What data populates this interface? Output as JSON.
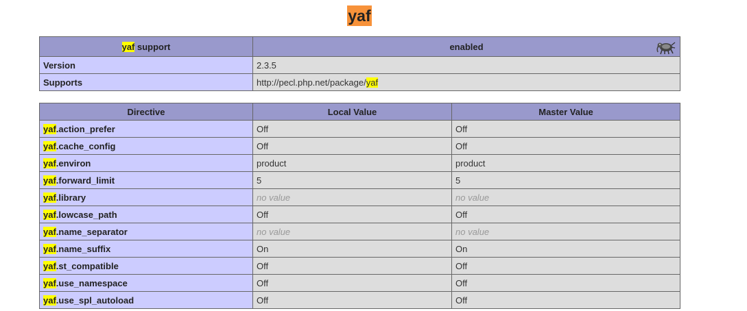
{
  "highlight_colors": {
    "search_hit": "#ffff00",
    "current_hit": "#f7923a"
  },
  "title": "yaf",
  "info_table": {
    "header": {
      "name_prefix": "yaf",
      "name_suffix": " support",
      "value": "enabled"
    },
    "logo_icon": "elephant-icon",
    "rows": [
      {
        "label": "Version",
        "value": "2.3.5"
      },
      {
        "label": "Supports",
        "value_prefix": "http://pecl.php.net/package/",
        "value_hit": "yaf"
      }
    ]
  },
  "directive_table": {
    "headers": [
      "Directive",
      "Local Value",
      "Master Value"
    ],
    "prefix": "yaf",
    "no_value": "no value",
    "rows": [
      {
        "name": ".action_prefer",
        "local": "Off",
        "master": "Off"
      },
      {
        "name": ".cache_config",
        "local": "Off",
        "master": "Off"
      },
      {
        "name": ".environ",
        "local": "product",
        "master": "product"
      },
      {
        "name": ".forward_limit",
        "local": "5",
        "master": "5"
      },
      {
        "name": ".library",
        "local": "no value",
        "master": "no value",
        "local_nv": true,
        "master_nv": true
      },
      {
        "name": ".lowcase_path",
        "local": "Off",
        "master": "Off"
      },
      {
        "name": ".name_separator",
        "local": "no value",
        "master": "no value",
        "local_nv": true,
        "master_nv": true
      },
      {
        "name": ".name_suffix",
        "local": "On",
        "master": "On"
      },
      {
        "name": ".st_compatible",
        "local": "Off",
        "master": "Off"
      },
      {
        "name": ".use_namespace",
        "local": "Off",
        "master": "Off"
      },
      {
        "name": ".use_spl_autoload",
        "local": "Off",
        "master": "Off"
      }
    ]
  }
}
